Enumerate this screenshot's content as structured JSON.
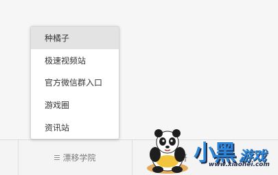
{
  "menu": {
    "items": [
      {
        "label": "种橘子",
        "active": true
      },
      {
        "label": "极速视频站",
        "active": false
      },
      {
        "label": "官方微信群入口",
        "active": false
      },
      {
        "label": "游戏圈",
        "active": false
      },
      {
        "label": "资讯站",
        "active": false
      }
    ]
  },
  "bottom_bar": {
    "tab_label": "漂移学院",
    "tab_icon": "menu-icon",
    "partial_label": "哥"
  },
  "watermark": {
    "logo_text_1": "小黑",
    "logo_text_2": "游戏",
    "url": "www.xiaohei.com"
  },
  "colors": {
    "active_item_bg": "#e3e3e3",
    "logo_blue": "#2e86d8",
    "logo_dark": "#1d2c4a"
  }
}
